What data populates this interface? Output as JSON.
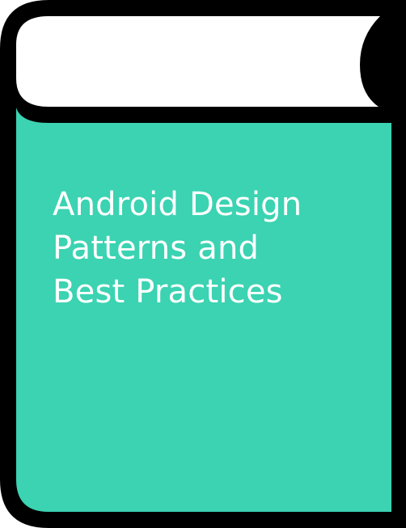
{
  "book": {
    "icon_name": "book-icon",
    "title_lines": [
      "Android Design",
      "Patterns and",
      "Best Practices"
    ]
  },
  "colors": {
    "cover": "#3bd3b2",
    "outline": "#000000",
    "pages": "#ffffff",
    "title_text": "#ffffff"
  }
}
